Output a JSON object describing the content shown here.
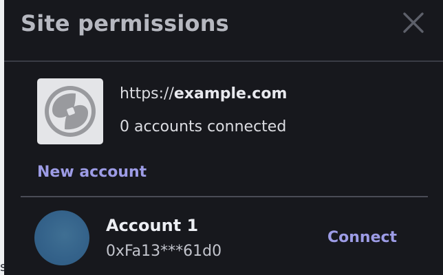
{
  "dialog": {
    "title": "Site permissions",
    "close_icon": "close-icon"
  },
  "site": {
    "icon": "site-favicon",
    "url_scheme": "https://",
    "url_domain": "example.com",
    "status": "0 accounts connected"
  },
  "new_account": {
    "label": "New account"
  },
  "accounts": [
    {
      "name": "Account 1",
      "address": "0xFa13***61d0",
      "action_label": "Connect",
      "avatar_color": "#34628a"
    }
  ],
  "colors": {
    "panel_background": "#17181d",
    "title_text": "#b6b8c0",
    "accent_link": "#9d9ce6",
    "divider": "#3a3c45",
    "icon_tile_background": "#e4e5e8"
  },
  "backdrop": {
    "partial_glyph": "s"
  }
}
